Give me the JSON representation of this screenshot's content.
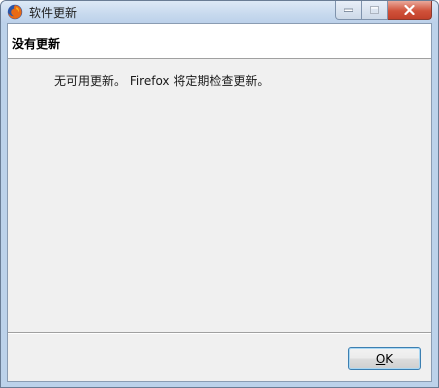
{
  "window": {
    "title": "软件更新",
    "app_icon": "firefox-icon",
    "caption_buttons": [
      "minimize-icon",
      "maximize-icon",
      "close-icon"
    ]
  },
  "header": {
    "title": "没有更新"
  },
  "main": {
    "message": "无可用更新。 Firefox 将定期检查更新。"
  },
  "footer": {
    "ok_mnemonic": "O",
    "ok_rest": "K"
  },
  "colors": {
    "title_bar": "#c7d9ee",
    "client_background": "#f0f0f0",
    "header_background": "#ffffff",
    "ok_border": "#3c7fb1",
    "close_button": "#c2402a"
  }
}
